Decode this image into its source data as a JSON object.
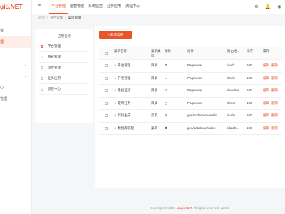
{
  "app": {
    "logo": "gic.NET"
  },
  "sidebar": {
    "items": [
      {
        "label": "",
        "chevron": ""
      },
      {
        "label": "台",
        "chevron": ""
      },
      {
        "label": "理",
        "chevron": ""
      },
      {
        "label": "",
        "chevron": "⌄"
      },
      {
        "label": "",
        "chevron": "⌄"
      },
      {
        "label": "",
        "chevron": "⌄"
      },
      {
        "label": "心",
        "chevron": ""
      },
      {
        "label": "管理",
        "chevron": ""
      }
    ]
  },
  "topnav": {
    "menu_icon": "≡",
    "items": [
      "平台管理",
      "运营管理",
      "系统监控",
      "业务应用",
      "流程中心"
    ],
    "icons": {
      "settings": "⚙",
      "bell": "🔔",
      "user": "◉"
    }
  },
  "breadcrumb": [
    "首页",
    "平台管理",
    "菜单管理"
  ],
  "app_panel": {
    "header": "应用名称",
    "items": [
      "平台管理",
      "系统管理",
      "运营管理",
      "业务应用",
      "流程中心"
    ],
    "selected": 0
  },
  "main": {
    "add_button": "+ 新增菜单",
    "columns": {
      "name": "菜单名称",
      "type": "菜单类\n型",
      "icon": "图标",
      "component": "组件",
      "route": "路由地...",
      "sort": "排序",
      "ops": "操作"
    },
    "rows": [
      {
        "name": "平台管理",
        "type": "目录",
        "icon": "⚙",
        "component": "PageView",
        "route": "/auth",
        "sort": "100",
        "edit": "编辑",
        "del": "删除"
      },
      {
        "name": "开发管理",
        "type": "目录",
        "icon": "▭",
        "component": "PageView",
        "route": "/tools",
        "sort": "100",
        "edit": "编辑",
        "del": "删除"
      },
      {
        "name": "系统监控",
        "type": "目录",
        "icon": "⚠",
        "component": "PageView",
        "route": "/monitor",
        "sort": "100",
        "edit": "编辑",
        "del": "删除"
      },
      {
        "name": "定时任务",
        "type": "目录",
        "icon": "◷",
        "component": "PageView",
        "route": "/timer",
        "sort": "100",
        "edit": "编辑",
        "del": "删除"
      },
      {
        "name": "代码生成",
        "type": "菜单",
        "icon": "⚲",
        "component": "gen/codeGenerate/in...",
        "route": "/code...",
        "sort": "100",
        "edit": "编辑",
        "del": "删除"
      },
      {
        "name": "数据库管理",
        "type": "菜单",
        "icon": "⛃",
        "component": "gen/database/index",
        "route": "/datab...",
        "sort": "100",
        "edit": "编辑",
        "del": "删除"
      }
    ]
  },
  "footer": {
    "prefix": "Copyright © 2021 ",
    "brand": "Magic.NET",
    "suffix": " All rights reserved. v1.0.2"
  },
  "colors": {
    "accent": "#e8552b"
  }
}
